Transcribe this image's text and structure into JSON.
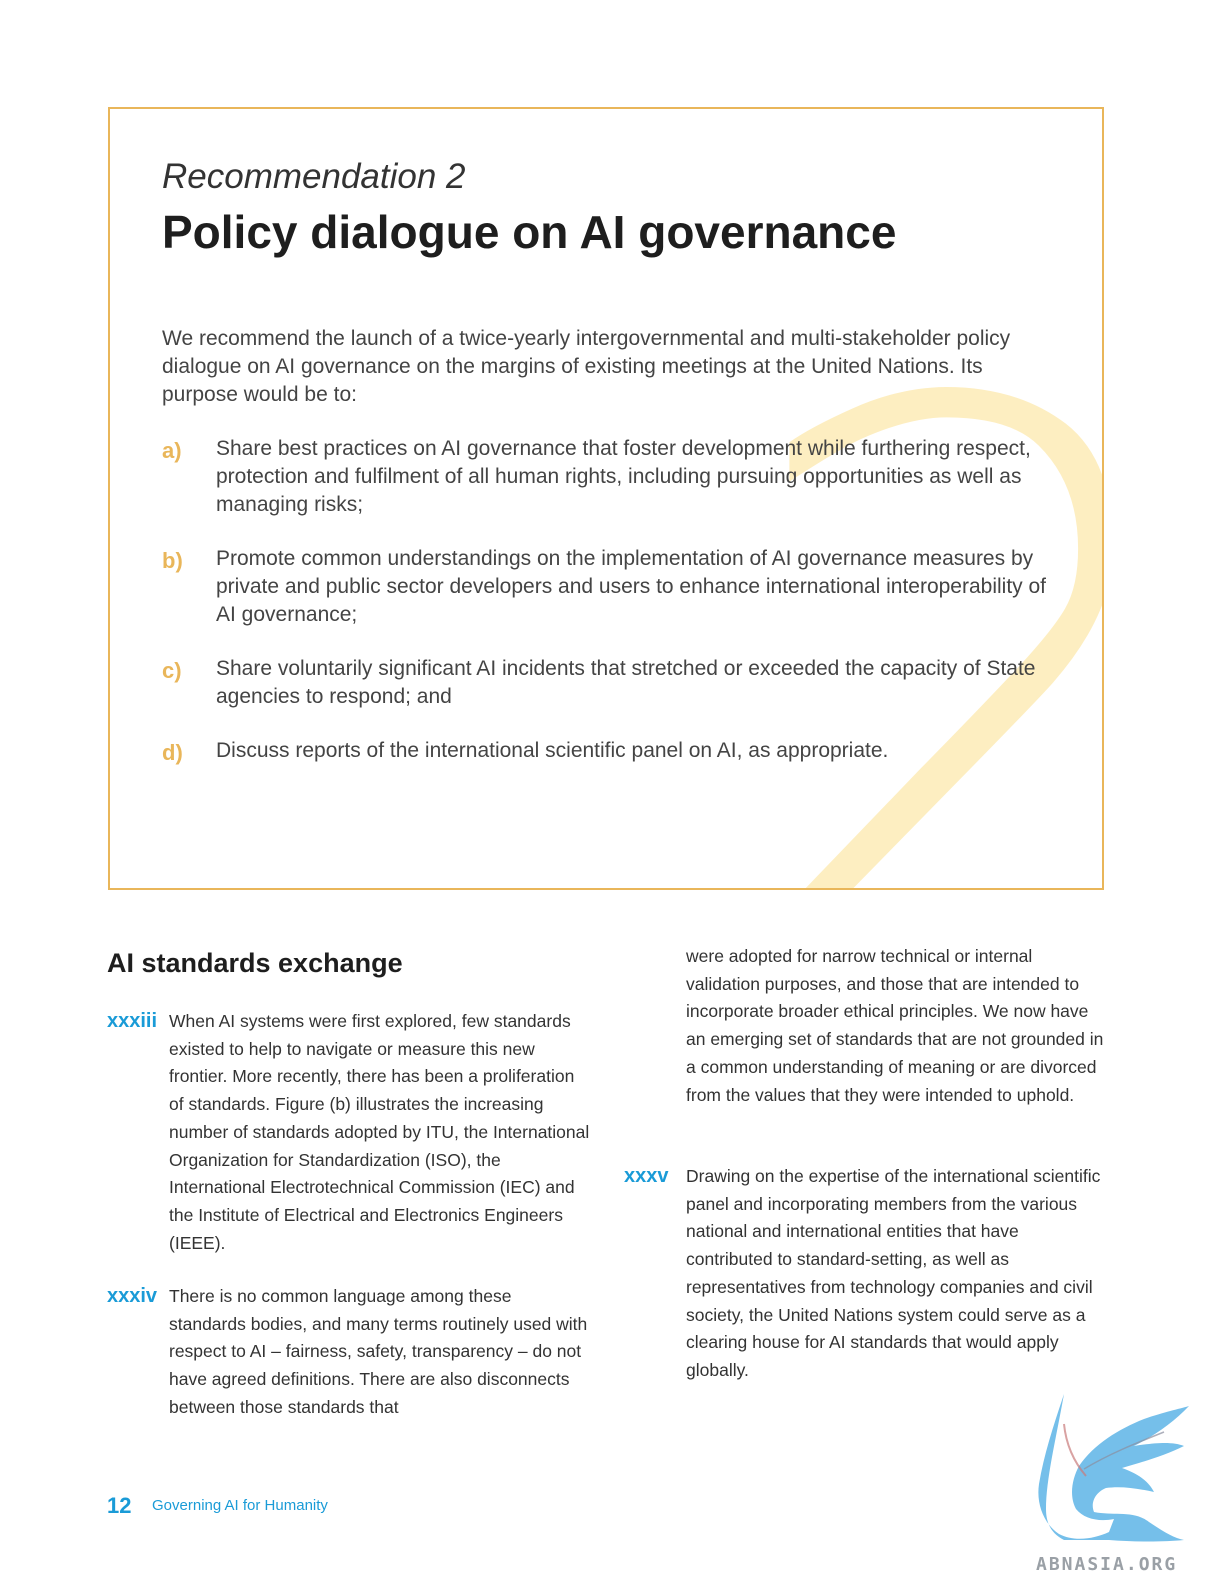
{
  "recommendation": {
    "kicker": "Recommendation 2",
    "title": "Policy dialogue on AI governance",
    "big_numeral": "2",
    "intro": "We recommend the launch of a twice-yearly intergovernmental and multi-stakeholder policy dialogue on AI governance on the margins of existing meetings at the United Nations. Its purpose would be to:",
    "items": [
      {
        "marker": "a)",
        "text": "Share best practices on AI governance that foster development while furthering respect, protection and fulfilment of all human rights, including pursuing opportunities as well as managing risks;"
      },
      {
        "marker": "b)",
        "text": "Promote common understandings on the implementation of AI governance measures by private and public sector developers and users to enhance international interoperability of AI governance;"
      },
      {
        "marker": "c)",
        "text": "Share voluntarily significant AI incidents that stretched or exceeded the capacity of State agencies to respond; and"
      },
      {
        "marker": "d)",
        "text": "Discuss reports of the international scientific panel on AI, as appropriate."
      }
    ]
  },
  "section": {
    "title": "AI standards exchange",
    "paragraphs": [
      {
        "number": "xxxiii",
        "text": "When AI systems were first explored, few standards existed to help to navigate or measure this new frontier. More recently, there has been a proliferation of standards. Figure (b) illustrates the increasing number of standards adopted by ITU, the International Organization for Standardization (ISO), the International Electrotechnical Commission (IEC) and the Institute of Electrical and Electronics Engineers (IEEE)."
      },
      {
        "number": "xxxiv",
        "text": "There is no common language among these standards bodies, and many terms routinely used with respect to AI – fairness, safety, transparency – do not have agreed definitions. There are also disconnects between those standards that",
        "continuation": "were adopted for narrow technical or internal validation purposes, and those that are intended to incorporate broader ethical principles. We now have an emerging set of standards that are not grounded in a common understanding of meaning or are divorced from the values that they were intended to uphold."
      },
      {
        "number": "xxxv",
        "text": "Drawing on the expertise of the international scientific panel and incorporating members from the various national and international entities that have contributed to standard-setting, as well as representatives from technology companies and civil society, the United Nations system could serve as a clearing house for AI standards that would apply globally."
      }
    ]
  },
  "footer": {
    "page_number": "12",
    "publication_title": "Governing AI for Humanity"
  },
  "watermark": {
    "text": "ABNASIA.ORG",
    "icon": "griffin-icon"
  },
  "colors": {
    "accent_gold": "#e9b65a",
    "numeral_yellow": "#fde9ad",
    "accent_blue": "#1a9bd7"
  }
}
